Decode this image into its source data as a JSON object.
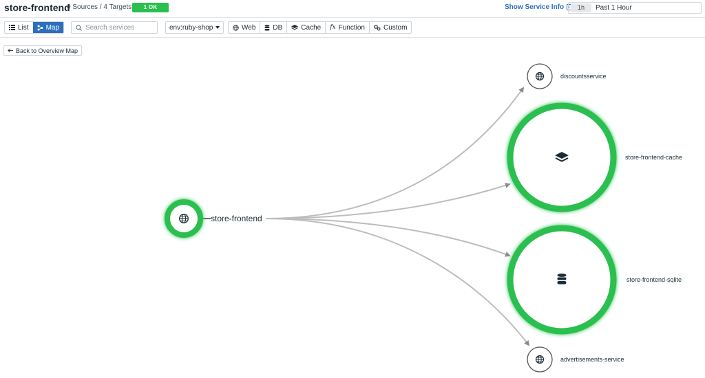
{
  "header": {
    "service_name": "store-frontend",
    "sources_targets": "0 Sources / 4 Targets",
    "status_badge": "1 OK",
    "show_info_label": "Show Service Info",
    "time_chip": "1h",
    "time_range": "Past 1 Hour"
  },
  "toolbar": {
    "list_label": "List",
    "map_label": "Map",
    "active_view": "Map",
    "search_placeholder": "Search services",
    "env_value": "env:ruby-shop",
    "filters": [
      {
        "label": "Web",
        "icon": "globe-icon"
      },
      {
        "label": "DB",
        "icon": "database-icon"
      },
      {
        "label": "Cache",
        "icon": "layers-icon"
      },
      {
        "label": "Function",
        "icon": "function-icon"
      },
      {
        "label": "Custom",
        "icon": "cogs-icon"
      }
    ]
  },
  "back_label": "Back to Overview Map",
  "map": {
    "colors": {
      "healthy": "#2bbf4f",
      "edge": "#bdbdbd",
      "arrow": "#8c8c8c"
    },
    "center": {
      "name": "store-frontend",
      "icon": "globe-icon"
    },
    "targets": [
      {
        "name": "discountsservice",
        "icon": "globe-icon"
      },
      {
        "name": "store-frontend-cache",
        "icon": "layers-icon"
      },
      {
        "name": "store-frontend-sqlite",
        "icon": "database-icon"
      },
      {
        "name": "advertisements-service",
        "icon": "globe-icon"
      }
    ]
  }
}
